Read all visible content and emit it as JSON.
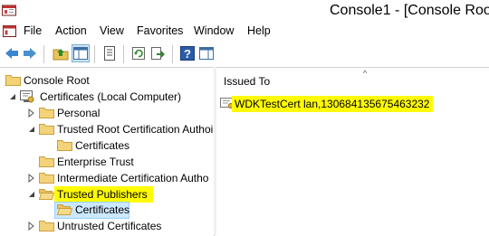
{
  "window": {
    "title": "Console1 - [Console Root"
  },
  "menu": {
    "items": [
      {
        "label": "File",
        "name": "menu-file"
      },
      {
        "label": "Action",
        "name": "menu-action"
      },
      {
        "label": "View",
        "name": "menu-view"
      },
      {
        "label": "Favorites",
        "name": "menu-favorites"
      },
      {
        "label": "Window",
        "name": "menu-window"
      },
      {
        "label": "Help",
        "name": "menu-help"
      }
    ]
  },
  "toolbar": {
    "buttons": [
      "back-arrow-icon",
      "forward-arrow-icon",
      "up-folder-icon",
      "show-hide-tree-icon",
      "properties-icon",
      "refresh-icon",
      "export-list-icon",
      "help-icon",
      "show-action-pane-icon"
    ]
  },
  "tree": {
    "items": [
      {
        "label": "Console Root",
        "icon": "folder-icon"
      },
      {
        "label": "Certificates (Local Computer)",
        "icon": "certificates-snapin-icon"
      },
      {
        "label": "Personal",
        "icon": "folder-icon"
      },
      {
        "label": "Trusted Root Certification Authoi",
        "icon": "folder-icon"
      },
      {
        "label": "Certificates",
        "icon": "folder-icon"
      },
      {
        "label": "Enterprise Trust",
        "icon": "folder-icon"
      },
      {
        "label": "Intermediate Certification Autho",
        "icon": "folder-icon"
      },
      {
        "label": "Trusted Publishers",
        "icon": "folder-open-icon"
      },
      {
        "label": "Certificates",
        "icon": "folder-open-icon"
      },
      {
        "label": "Untrusted Certificates",
        "icon": "folder-icon"
      }
    ]
  },
  "list": {
    "column": "Issued To",
    "sort_indicator": "^",
    "rows": [
      {
        "issued_to": "WDKTestCert lan,130684135675463232",
        "icon": "certificate-icon"
      }
    ]
  },
  "colors": {
    "highlight": "#fffb00",
    "selection": "#cce8ff",
    "selection_border": "#99d1ff"
  }
}
